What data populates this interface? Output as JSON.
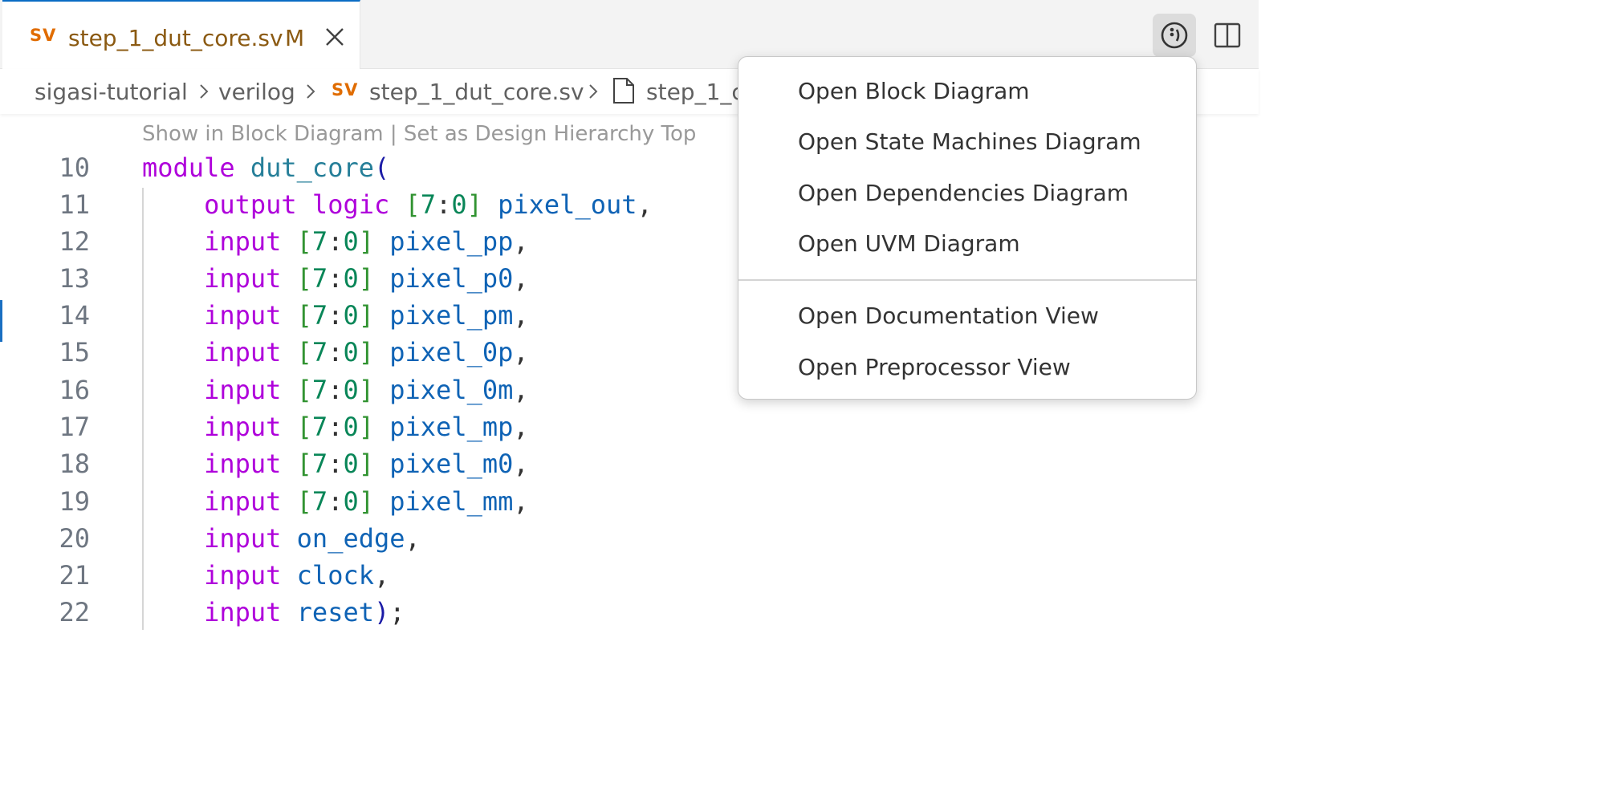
{
  "tab": {
    "badge": "SV",
    "title": "step_1_dut_core.sv",
    "modified": "M"
  },
  "actions": {
    "more_icon": "info-circle-icon",
    "split_icon": "split-editor-icon"
  },
  "breadcrumb": {
    "items": [
      "sigasi-tutorial",
      "verilog",
      "step_1_dut_core.sv",
      "step_1_c"
    ],
    "badge": "SV"
  },
  "codelens": "Show in Block Diagram | Set as Design Hierarchy Top",
  "code": {
    "line_numbers": [
      "10",
      "11",
      "12",
      "13",
      "14",
      "15",
      "16",
      "17",
      "18",
      "19",
      "20",
      "21",
      "22"
    ],
    "module_kw": "module",
    "module_name": "dut_core",
    "open_paren": "(",
    "out_kw": "output",
    "logic_kw": "logic",
    "input_kw": "input",
    "range_open": "[",
    "range_hi": "7",
    "range_colon": ":",
    "range_lo": "0",
    "range_close": "]",
    "comma": ",",
    "ports": [
      "pixel_out",
      "pixel_pp",
      "pixel_p0",
      "pixel_pm",
      "pixel_0p",
      "pixel_0m",
      "pixel_mp",
      "pixel_m0",
      "pixel_mm",
      "on_edge",
      "clock",
      "reset"
    ],
    "close_paren": ")",
    "semicolon": ";"
  },
  "menu": {
    "items_group1": [
      "Open Block Diagram",
      "Open State Machines Diagram",
      "Open Dependencies Diagram",
      "Open UVM Diagram"
    ],
    "items_group2": [
      "Open Documentation View",
      "Open Preprocessor View"
    ]
  },
  "colors": {
    "accent": "#0a6cc4",
    "sv_badge": "#e06c00",
    "keyword": "#af00db",
    "identifier": "#0f63b5"
  }
}
